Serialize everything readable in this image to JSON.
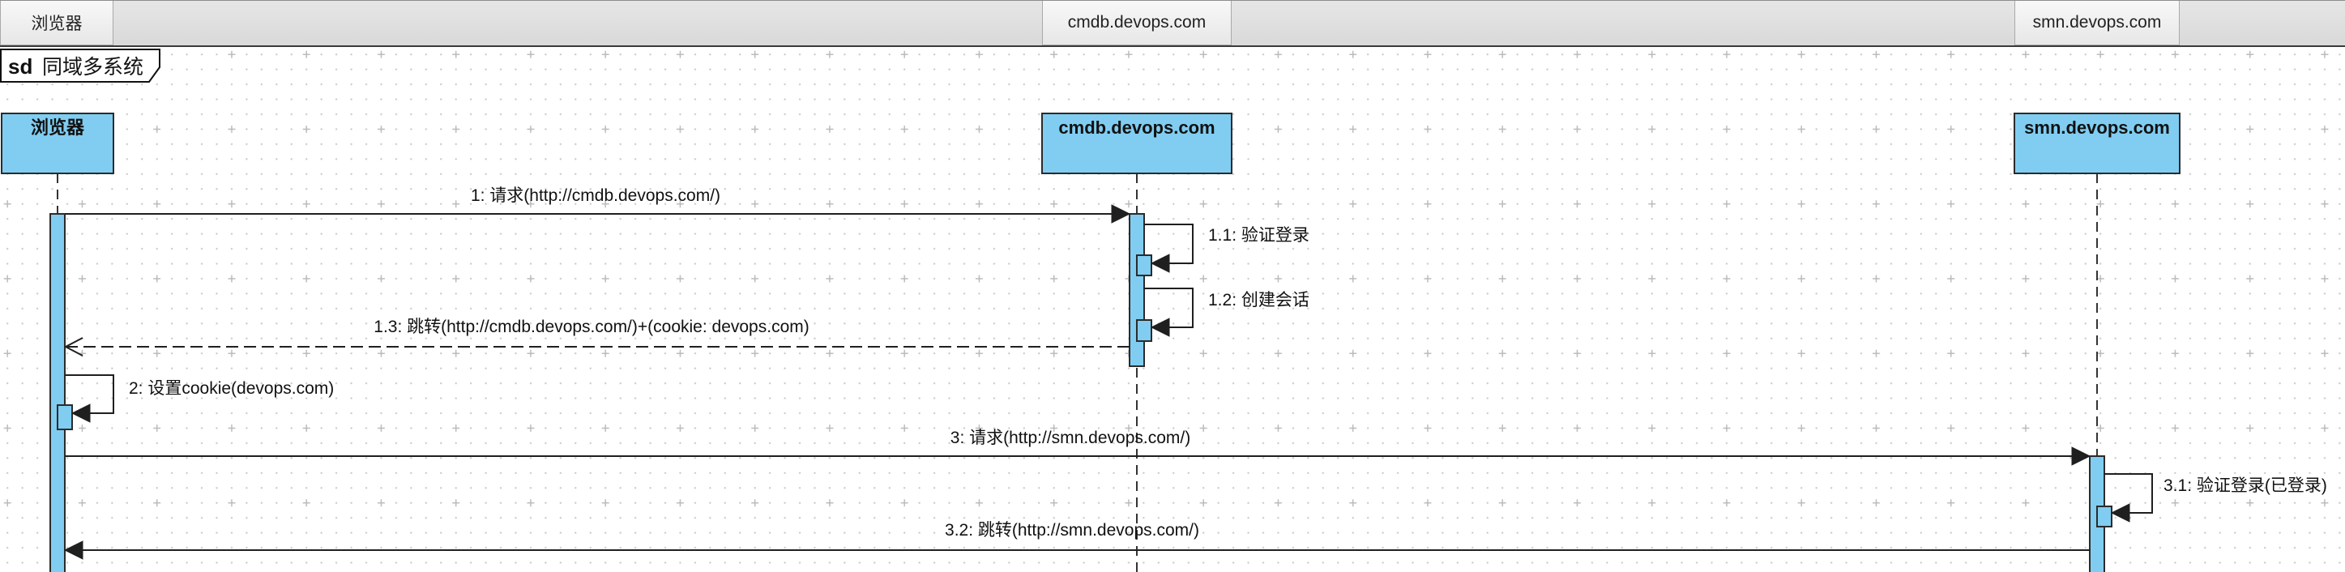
{
  "header": {
    "tabs": [
      {
        "label": "浏览器"
      },
      {
        "label": "cmdb.devops.com"
      },
      {
        "label": "smn.devops.com"
      }
    ]
  },
  "frame": {
    "keyword": "sd",
    "name": "同域多系统"
  },
  "lifelines": [
    {
      "name": "浏览器"
    },
    {
      "name": "cmdb.devops.com"
    },
    {
      "name": "smn.devops.com"
    }
  ],
  "messages": [
    {
      "label": "1: 请求(http://cmdb.devops.com/)"
    },
    {
      "label": "1.1: 验证登录"
    },
    {
      "label": "1.2: 创建会话"
    },
    {
      "label": "1.3: 跳转(http://cmdb.devops.com/)+(cookie: devops.com)"
    },
    {
      "label": "2: 设置cookie(devops.com)"
    },
    {
      "label": "3: 请求(http://smn.devops.com/)"
    },
    {
      "label": "3.1: 验证登录(已登录)"
    },
    {
      "label": "3.2: 跳转(http://smn.devops.com/)"
    }
  ],
  "colors": {
    "lifeline_fill": "#80CDF1",
    "line": "#1F1F1F",
    "header_bar": "#D9D9D9"
  }
}
